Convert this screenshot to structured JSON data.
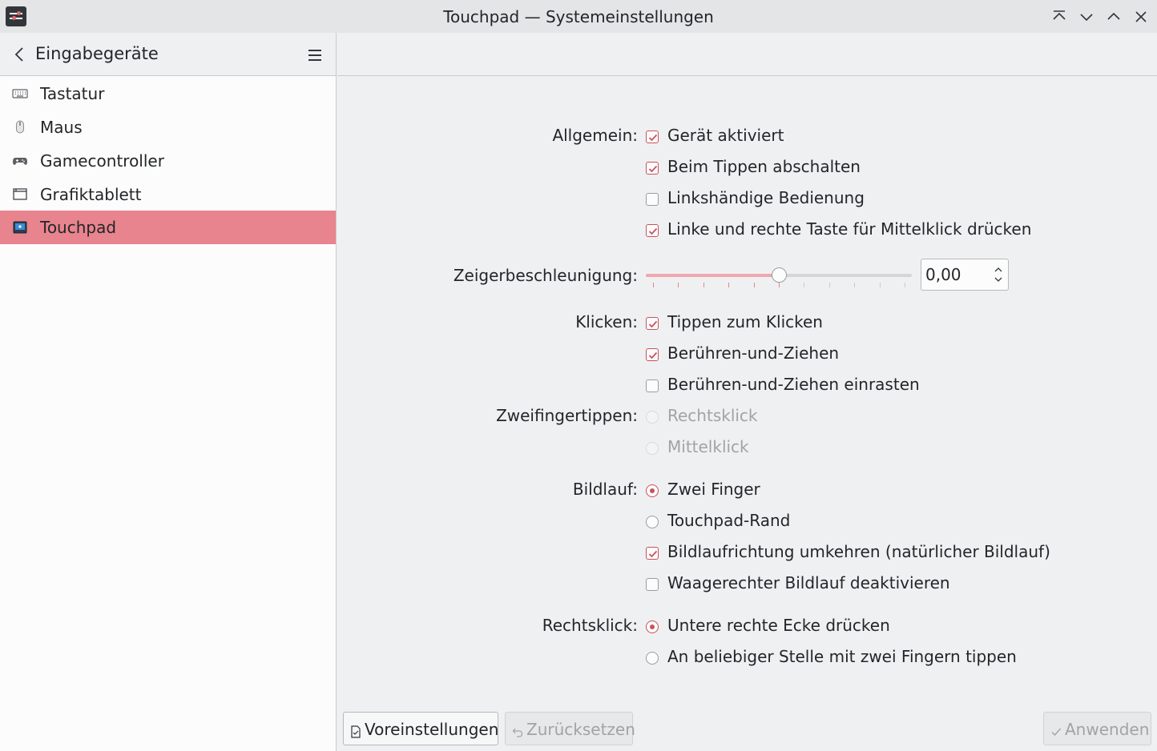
{
  "window": {
    "title": "Touchpad — Systemeinstellungen"
  },
  "sidebar": {
    "title": "Eingabegeräte",
    "items": [
      {
        "label": "Tastatur",
        "icon": "keyboard-icon",
        "active": false
      },
      {
        "label": "Maus",
        "icon": "mouse-icon",
        "active": false
      },
      {
        "label": "Gamecontroller",
        "icon": "gamepad-icon",
        "active": false
      },
      {
        "label": "Grafiktablett",
        "icon": "tablet-icon",
        "active": false
      },
      {
        "label": "Touchpad",
        "icon": "touchpad-icon",
        "active": true
      }
    ]
  },
  "settings": {
    "allgemein": {
      "label": "Allgemein:",
      "options": [
        {
          "label": "Gerät aktiviert",
          "checked": true
        },
        {
          "label": "Beim Tippen abschalten",
          "checked": true
        },
        {
          "label": "Linkshändige Bedienung",
          "checked": false
        },
        {
          "label": "Linke und rechte Taste für Mittelklick drücken",
          "checked": true
        }
      ]
    },
    "zeiger": {
      "label": "Zeigerbeschleunigung:",
      "value": "0,00",
      "slider_position": 0.5
    },
    "klicken": {
      "label": "Klicken:",
      "options": [
        {
          "label": "Tippen zum Klicken",
          "checked": true
        },
        {
          "label": "Berühren-und-Ziehen",
          "checked": true
        },
        {
          "label": "Berühren-und-Ziehen einrasten",
          "checked": false
        }
      ]
    },
    "zweifinger": {
      "label": "Zweifingertippen:",
      "options": [
        {
          "label": "Rechtsklick",
          "checked": false,
          "disabled": true
        },
        {
          "label": "Mittelklick",
          "checked": false,
          "disabled": true
        }
      ]
    },
    "bildlauf": {
      "label": "Bildlauf:",
      "radios": [
        {
          "label": "Zwei Finger",
          "checked": true
        },
        {
          "label": "Touchpad-Rand",
          "checked": false
        }
      ],
      "options": [
        {
          "label": "Bildlaufrichtung umkehren (natürlicher Bildlauf)",
          "checked": true
        },
        {
          "label": "Waagerechter Bildlauf deaktivieren",
          "checked": false
        }
      ]
    },
    "rechtsklick": {
      "label": "Rechtsklick:",
      "radios": [
        {
          "label": "Untere rechte Ecke drücken",
          "checked": true
        },
        {
          "label": "An beliebiger Stelle mit zwei Fingern tippen",
          "checked": false
        }
      ]
    }
  },
  "buttons": {
    "defaults": "Voreinstellungen",
    "reset": "Zurücksetzen",
    "apply": "Anwenden"
  },
  "colors": {
    "accent": "#e8848e",
    "check": "#c9525d"
  }
}
